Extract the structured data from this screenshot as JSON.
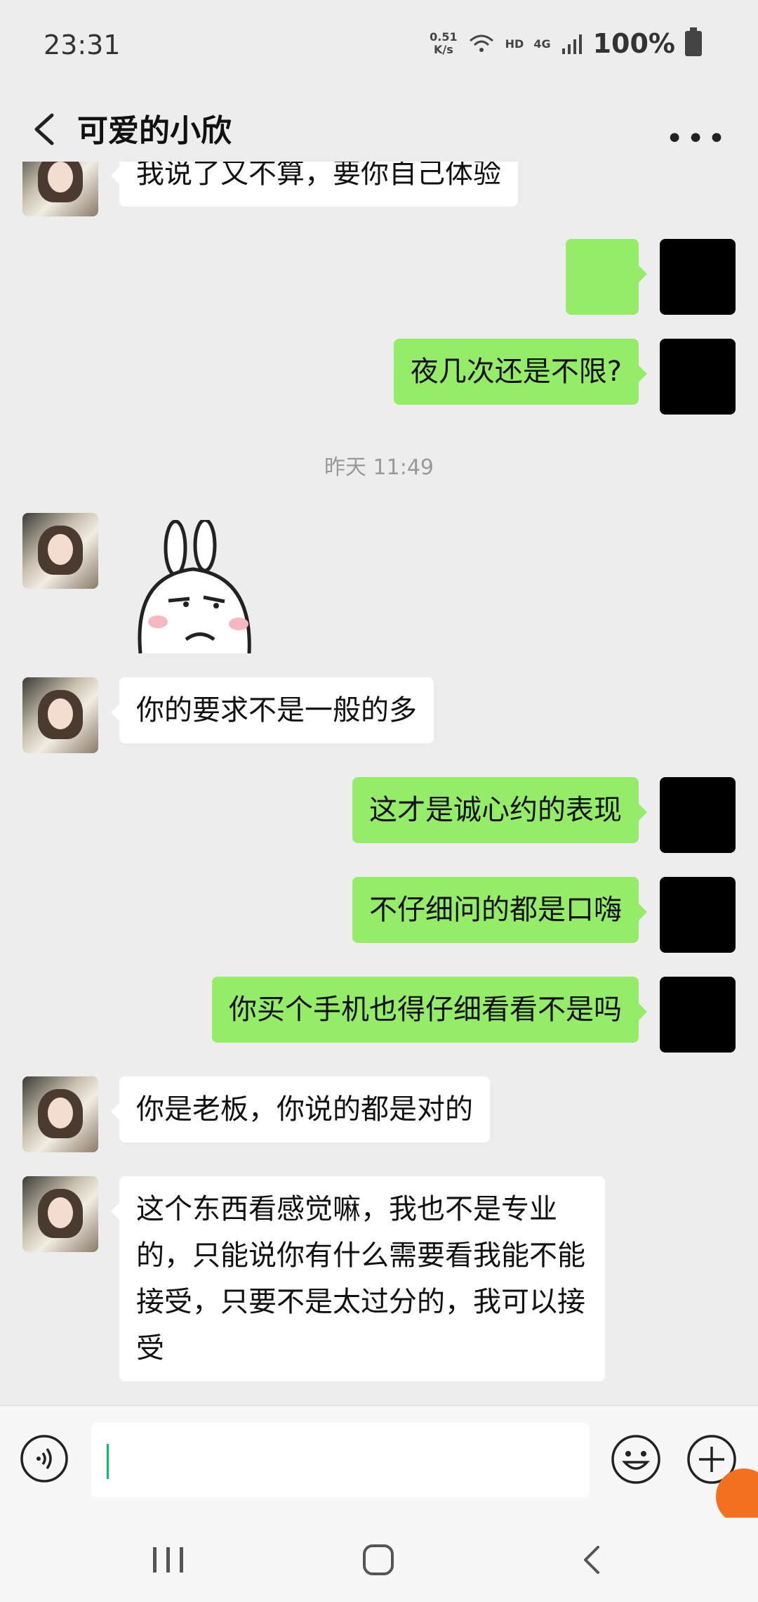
{
  "status_bar": {
    "time": "23:31",
    "net_speed_value": "0.51",
    "net_speed_unit": "K/s",
    "hd": "HD",
    "network": "4G",
    "battery": "100%"
  },
  "header": {
    "title": "可爱的小欣"
  },
  "messages": {
    "m0": "我说了又不算，要你自己体验",
    "m2": "夜几次还是不限?",
    "time_sep": "昨天 11:49",
    "m4": "你的要求不是一般的多",
    "m5": "这才是诚心约的表现",
    "m6": "不仔细问的都是口嗨",
    "m7": "你买个手机也得仔细看看不是吗",
    "m8": "你是老板，你说的都是对的",
    "m9": "这个东西看感觉嘛，我也不是专业\n的，只能说你有什么需要看我能不能\n接受，只要不是太过分的，我可以接\n受"
  },
  "colors": {
    "outgoing_bubble": "#95ec69",
    "incoming_bubble": "#ffffff",
    "background": "#ededed",
    "caret": "#07c160"
  },
  "icons": [
    "back-icon",
    "more-icon",
    "grinning-emoji-icon",
    "voice-icon",
    "emoji-icon",
    "plus-icon",
    "nav-recent-icon",
    "nav-home-icon",
    "nav-back-icon"
  ]
}
